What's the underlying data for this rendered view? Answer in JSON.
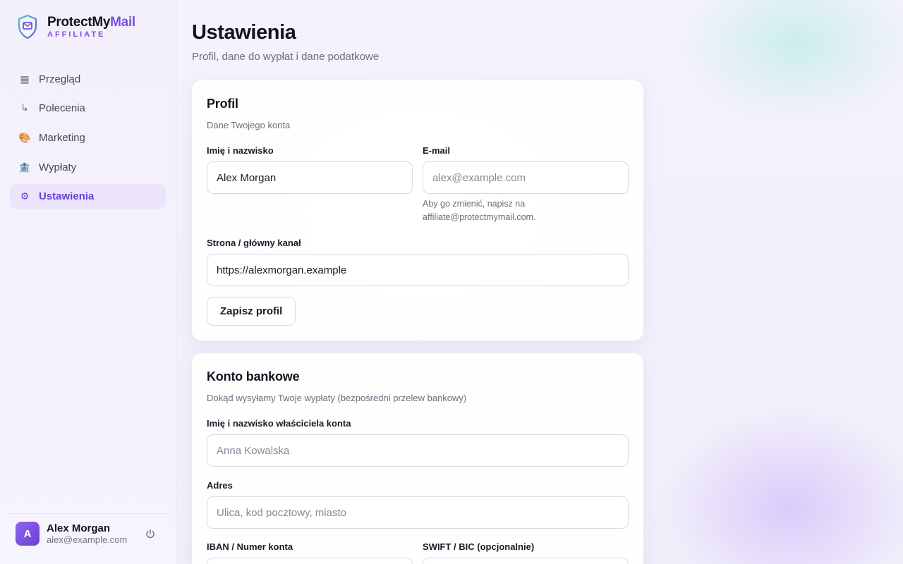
{
  "brand": {
    "name_part1": "ProtectMy",
    "name_part2": "Mail",
    "sub": "AFFILIATE"
  },
  "nav": {
    "items": [
      {
        "label": "Przegląd",
        "icon": "grid-icon",
        "glyph": "▦"
      },
      {
        "label": "Polecenia",
        "icon": "arrow-down-right-icon",
        "glyph": "↳"
      },
      {
        "label": "Marketing",
        "icon": "palette-icon",
        "glyph": "🎨"
      },
      {
        "label": "Wypłaty",
        "icon": "bank-icon",
        "glyph": "🏦"
      },
      {
        "label": "Ustawienia",
        "icon": "gear-icon",
        "glyph": "⚙"
      }
    ],
    "active": "Ustawienia"
  },
  "user": {
    "initial": "A",
    "name": "Alex Morgan",
    "email": "alex@example.com"
  },
  "page": {
    "title": "Ustawienia",
    "subtitle": "Profil, dane do wypłat i dane podatkowe"
  },
  "profile": {
    "title": "Profil",
    "desc": "Dane Twojego konta",
    "name_label": "Imię i nazwisko",
    "name_value": "Alex Morgan",
    "email_label": "E-mail",
    "email_placeholder": "alex@example.com",
    "email_help": "Aby go zmienić, napisz na affiliate@protectmymail.com.",
    "site_label": "Strona / główny kanał",
    "site_value": "https://alexmorgan.example",
    "save_label": "Zapisz profil"
  },
  "bank": {
    "title": "Konto bankowe",
    "desc": "Dokąd wysyłamy Twoje wypłaty (bezpośredni przelew bankowy)",
    "owner_label": "Imię i nazwisko właściciela konta",
    "owner_placeholder": "Anna Kowalska",
    "address_label": "Adres",
    "address_placeholder": "Ulica, kod pocztowy, miasto",
    "iban_label": "IBAN / Numer konta",
    "swift_label": "SWIFT / BIC (opcjonalnie)"
  },
  "colors": {
    "accent": "#7b4fe0",
    "active_bg": "#ebe4fb"
  }
}
